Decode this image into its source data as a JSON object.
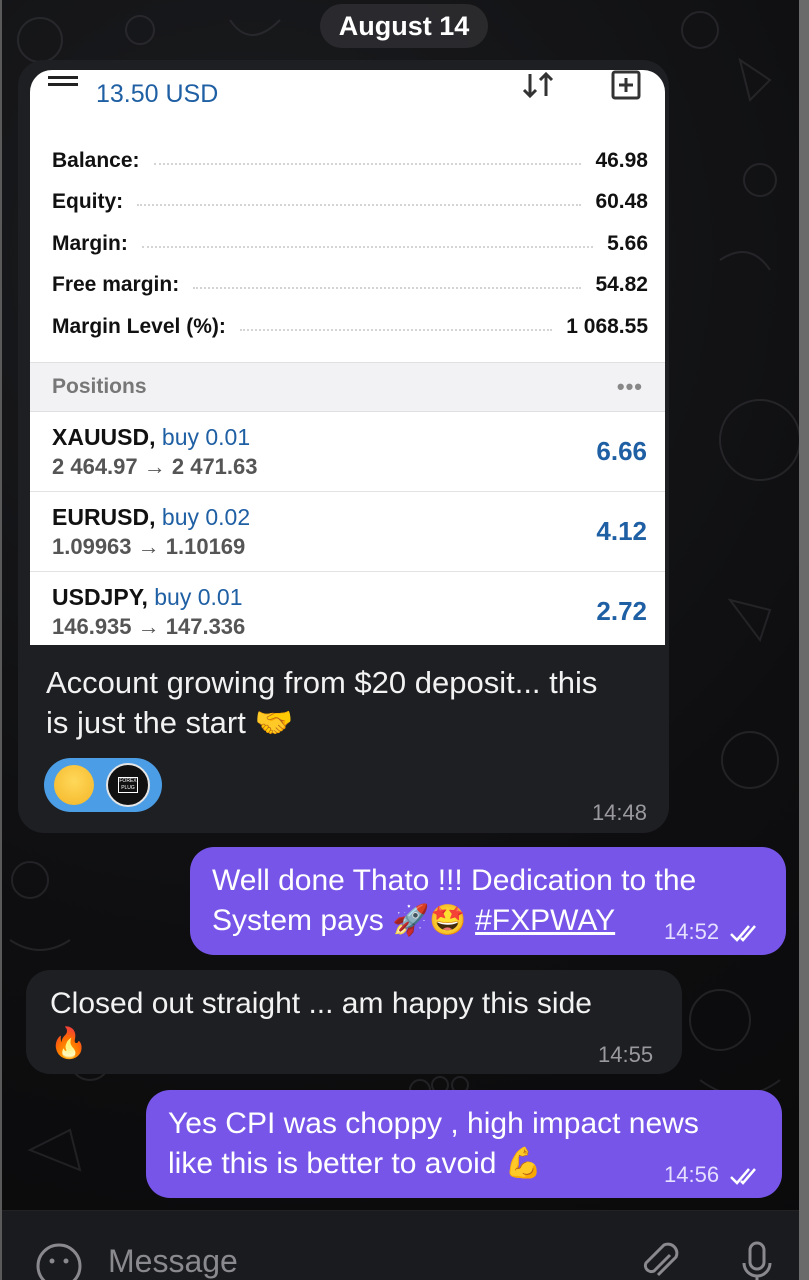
{
  "date_label": "August 14",
  "mt_screenshot": {
    "balance_title": "13.50 USD",
    "account": [
      {
        "label": "Balance:",
        "value": "46.98"
      },
      {
        "label": "Equity:",
        "value": "60.48"
      },
      {
        "label": "Margin:",
        "value": "5.66"
      },
      {
        "label": "Free margin:",
        "value": "54.82"
      },
      {
        "label": "Margin Level (%):",
        "value": "1 068.55"
      }
    ],
    "positions_title": "Positions",
    "more": "•••",
    "positions": [
      {
        "symbol": "XAUUSD,",
        "side": "buy 0.01",
        "prices": "2 464.97 → 2 471.63",
        "profit": "6.66"
      },
      {
        "symbol": "EURUSD,",
        "side": "buy 0.02",
        "prices": "1.09963 → 1.10169",
        "profit": "4.12"
      },
      {
        "symbol": "USDJPY,",
        "side": "buy 0.01",
        "prices": "146.935 → 147.336",
        "profit": "2.72"
      }
    ]
  },
  "messages": [
    {
      "direction": "in",
      "text_line1": "Account growing from $20 deposit... this",
      "text_line2": "is just the start 🤝",
      "time": "14:48"
    },
    {
      "direction": "out",
      "text_line1": "Well done Thato !!! Dedication to the",
      "text_line2_pre": "System pays 🚀🤩 ",
      "hashtag": "#FXPWAY",
      "time": "14:52"
    },
    {
      "direction": "in",
      "text_line1": "Closed out straight ... am happy this side",
      "text_line2": "🔥",
      "time": "14:55"
    },
    {
      "direction": "out",
      "text_line1": "Yes CPI was choppy , high impact news",
      "text_line2": "like this is better to avoid 💪",
      "time": "14:56"
    }
  ],
  "reaction": {
    "emoji": "😁",
    "avatar_text": "FOREX PLUG"
  },
  "composer": {
    "placeholder": "Message"
  },
  "colors": {
    "outgoing_bubble": "#7655e8",
    "incoming_bubble": "#1e1f23",
    "mt_blue": "#1f5fa3"
  }
}
